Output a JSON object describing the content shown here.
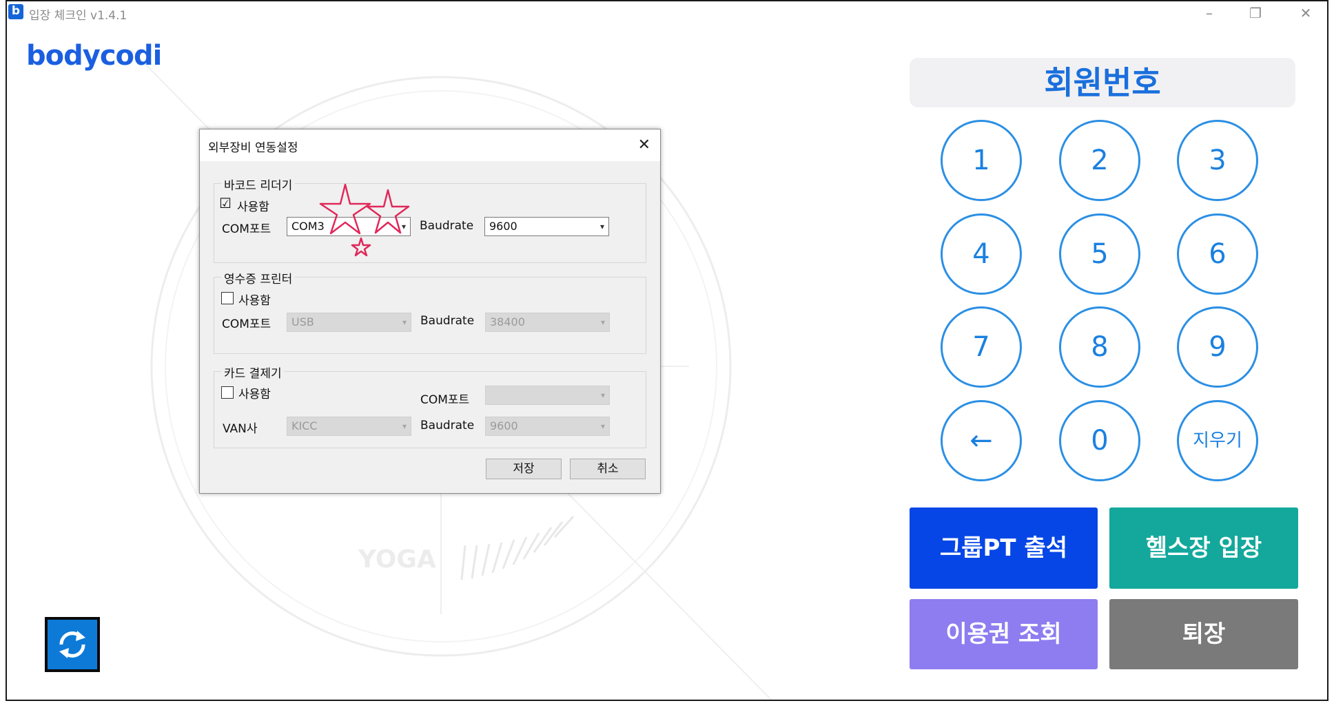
{
  "window": {
    "app_icon": "b",
    "title": "입장 체크인 v1.4.1",
    "controls": [
      "minimize-icon",
      "restore-icon",
      "close-icon"
    ]
  },
  "brand": {
    "logo": "bodycodi"
  },
  "background": {
    "watermark": "YOGA"
  },
  "member_input": {
    "label": "회원번호"
  },
  "keypad": {
    "keys": [
      "1",
      "2",
      "3",
      "4",
      "5",
      "6",
      "7",
      "8",
      "9",
      "←",
      "0",
      "지우기"
    ]
  },
  "actions": {
    "group_pt": {
      "label": "그룹PT 출석",
      "color": "#0646e6"
    },
    "gym_entry": {
      "label": "헬스장 입장",
      "color": "#14a89c"
    },
    "pass_lookup": {
      "label": "이용권 조회",
      "color": "#8e7df0"
    },
    "exit": {
      "label": "퇴장",
      "color": "#7a7a7a"
    }
  },
  "dialog": {
    "title": "외부장비 연동설정",
    "barcode": {
      "title": "바코드 리더기",
      "use_label": "사용함",
      "use_checked": true,
      "com_label": "COM포트",
      "com_value": "COM3",
      "baud_label": "Baudrate",
      "baud_value": "9600"
    },
    "printer": {
      "title": "영수증 프린터",
      "use_label": "사용함",
      "use_checked": false,
      "com_label": "COM포트",
      "com_value": "USB",
      "baud_label": "Baudrate",
      "baud_value": "38400"
    },
    "card": {
      "title": "카드 결제기",
      "use_label": "사용함",
      "use_checked": false,
      "com_label": "COM포트",
      "com_value": "",
      "van_label": "VAN사",
      "van_value": "KICC",
      "baud_label": "Baudrate",
      "baud_value": "9600"
    },
    "save_label": "저장",
    "cancel_label": "취소",
    "check_mark": "☑",
    "close_glyph": "✕"
  }
}
